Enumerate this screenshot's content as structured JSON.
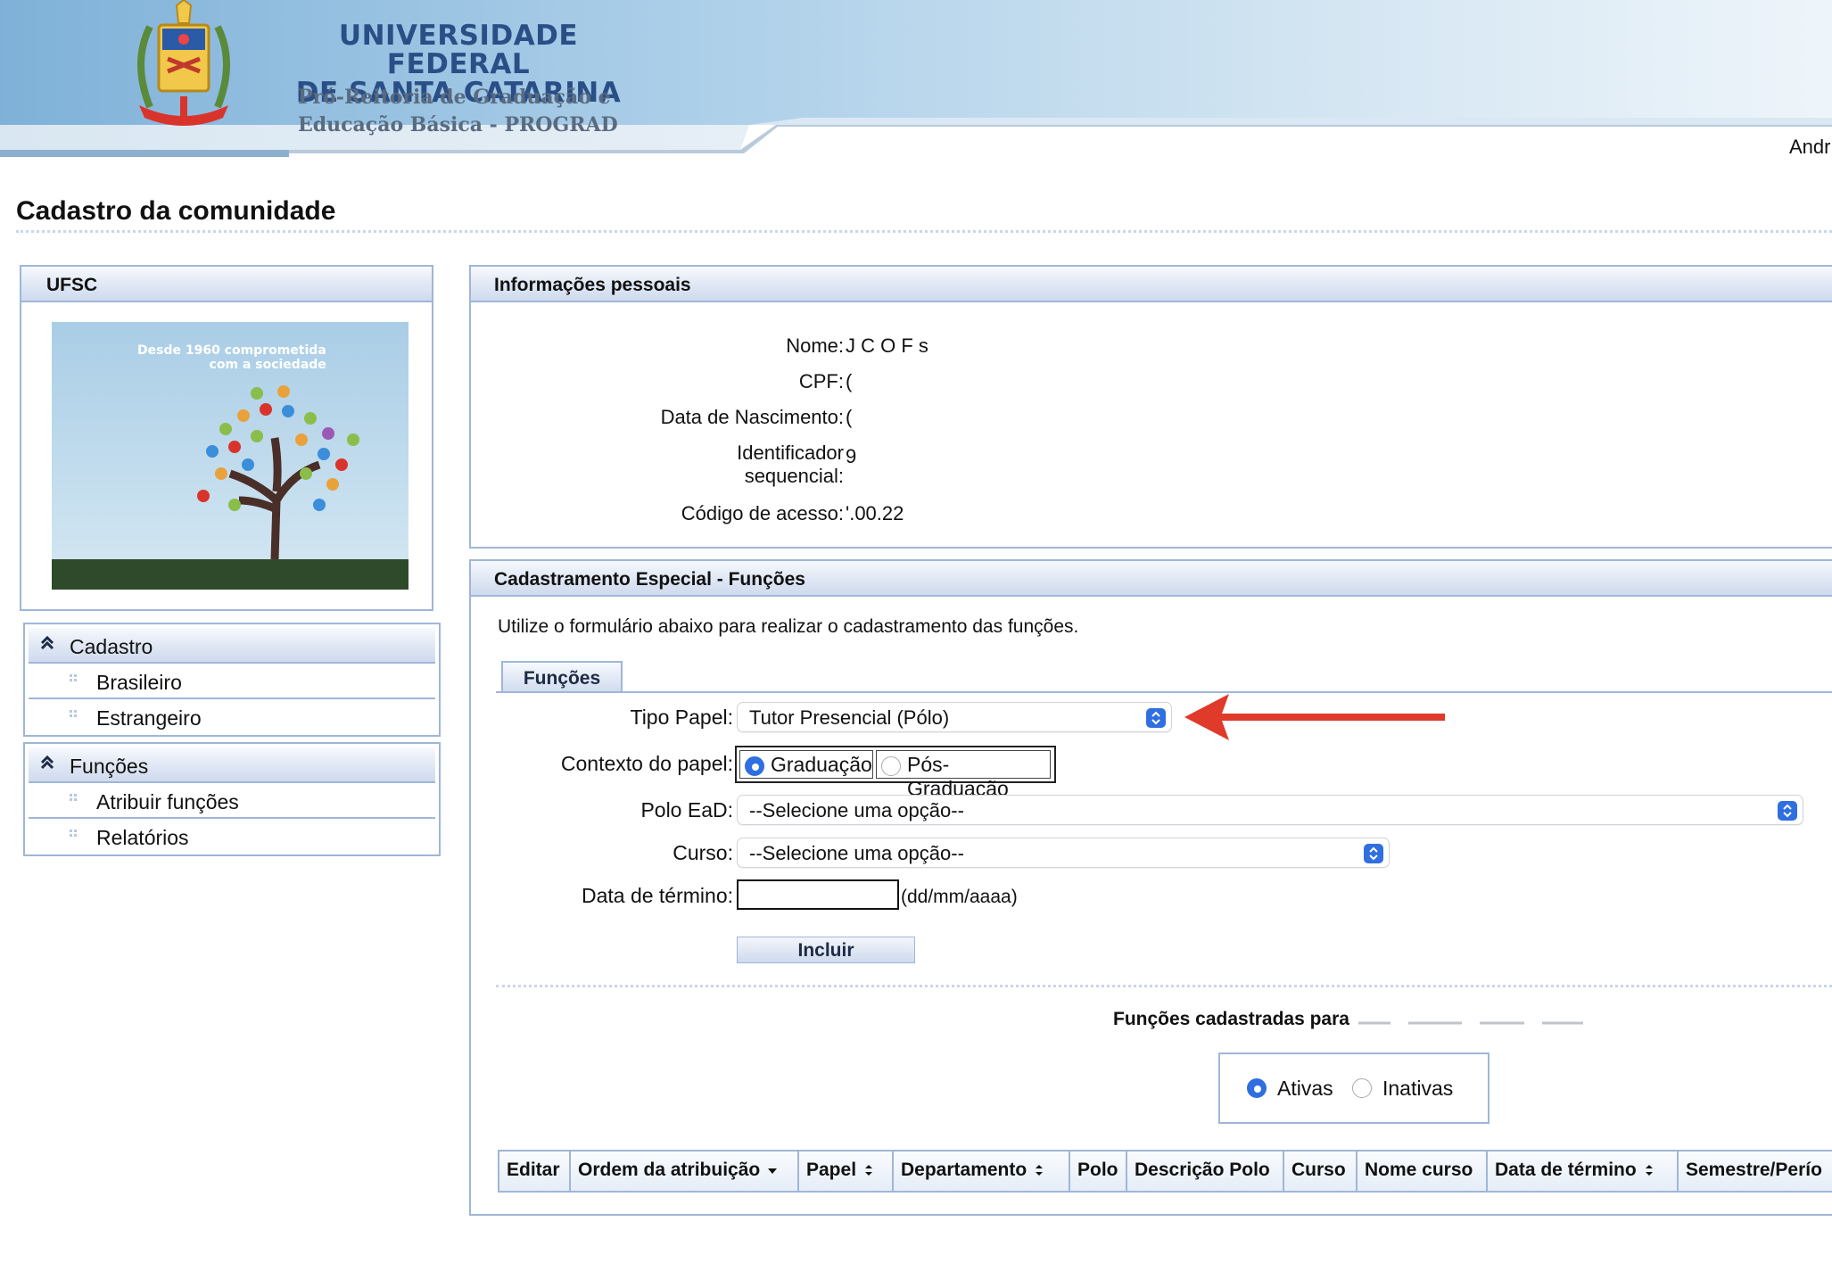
{
  "header": {
    "university_line1": "UNIVERSIDADE FEDERAL",
    "university_line2": "DE SANTA CATARINA",
    "subtitle_line1": "Pró-Reitoria de Graduação e",
    "subtitle_line2": "Educação Básica - PROGRAD",
    "user_name": "Andr"
  },
  "page_title": "Cadastro da comunidade",
  "ufsc_box": {
    "title": "UFSC",
    "slogan_line1": "Desde 1960 comprometida",
    "slogan_line2": "com a sociedade"
  },
  "sidebar": {
    "sections": [
      {
        "title": "Cadastro",
        "items": [
          {
            "label": "Brasileiro"
          },
          {
            "label": "Estrangeiro"
          }
        ]
      },
      {
        "title": "Funções",
        "items": [
          {
            "label": "Atribuir funções"
          },
          {
            "label": "Relatórios"
          }
        ]
      }
    ]
  },
  "info": {
    "title": "Informações pessoais",
    "fields": [
      {
        "label": "Nome:",
        "value": "J      C     O   F     s"
      },
      {
        "label": "CPF:",
        "value": "("
      },
      {
        "label": "Data de Nascimento:",
        "value": "("
      },
      {
        "label_line1": "Identificador",
        "label_line2": "sequencial:",
        "value": "9"
      },
      {
        "label": "Código de acesso:",
        "value": "'.00.22"
      }
    ]
  },
  "cadastramento": {
    "title": "Cadastramento Especial - Funções",
    "intro": "Utilize o formulário abaixo para realizar o cadastramento das funções.",
    "tab": "Funções",
    "tipo_papel": {
      "label": "Tipo Papel:",
      "value": "Tutor Presencial (Pólo)"
    },
    "contexto": {
      "label": "Contexto do papel:",
      "options": [
        "Graduação",
        "Pós-Graduação"
      ],
      "selected": "Graduação"
    },
    "polo": {
      "label": "Polo EaD:",
      "value": "--Selecione uma opção--"
    },
    "curso": {
      "label": "Curso:",
      "value": "--Selecione uma opção--"
    },
    "data_termino": {
      "label": "Data de término:",
      "value": "",
      "hint": "(dd/mm/aaaa)"
    },
    "submit": "Incluir",
    "list_title": "Funções cadastradas para ",
    "filter": {
      "options": [
        "Ativas",
        "Inativas"
      ],
      "selected": "Ativas"
    },
    "table": {
      "columns": [
        "Editar",
        "Ordem da atribuição",
        "Papel",
        "Departamento",
        "Polo",
        "Descrição Polo",
        "Curso",
        "Nome curso",
        "Data de término",
        "Semestre/Perío"
      ]
    }
  },
  "colors": {
    "accent": "#2f6fe0",
    "panel_border": "#9fb6d8",
    "brand_blue": "#2a4f86",
    "annotation_arrow": "#e03a2a"
  },
  "icons": {
    "collapse": "double-chevron-up-icon",
    "select_arrow": "up-down-arrows-icon",
    "sort_desc": "sort-descending-icon",
    "sort_both": "sort-icon",
    "menu_bullet": "dotted-bullet-icon"
  }
}
